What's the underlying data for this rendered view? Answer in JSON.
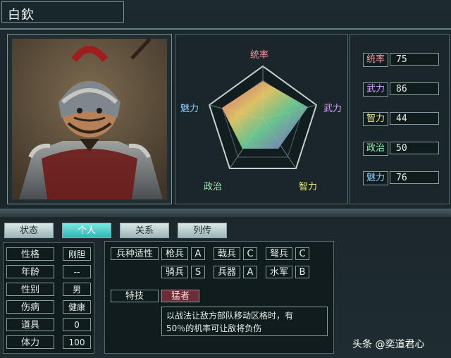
{
  "general": {
    "name": "白欽"
  },
  "radar": {
    "labels": {
      "top": "统率",
      "right": "武力",
      "bottom_right": "智力",
      "bottom_left": "政治",
      "left": "魅力"
    }
  },
  "stats": [
    {
      "label": "统率",
      "value": "75",
      "color": "#ff9aa5"
    },
    {
      "label": "武力",
      "value": "86",
      "color": "#d7a6ff"
    },
    {
      "label": "智力",
      "value": "44",
      "color": "#f2f17e"
    },
    {
      "label": "政治",
      "value": "50",
      "color": "#9ef0b8"
    },
    {
      "label": "魅力",
      "value": "76",
      "color": "#91d0ff"
    }
  ],
  "tabs": [
    {
      "label": "状态",
      "active": false
    },
    {
      "label": "个人",
      "active": true
    },
    {
      "label": "关系",
      "active": false
    },
    {
      "label": "列传",
      "active": false
    }
  ],
  "personal": [
    {
      "label": "性格",
      "value": "刚胆"
    },
    {
      "label": "年龄",
      "value": "--"
    },
    {
      "label": "性别",
      "value": "男"
    },
    {
      "label": "伤病",
      "value": "健康"
    },
    {
      "label": "道具",
      "value": "0"
    },
    {
      "label": "体力",
      "value": "100"
    }
  ],
  "aptitude": {
    "title": "兵种适性",
    "rows": [
      [
        {
          "unit": "枪兵",
          "grade": "A"
        },
        {
          "unit": "戟兵",
          "grade": "C"
        },
        {
          "unit": "弩兵",
          "grade": "C"
        }
      ],
      [
        {
          "unit": "骑兵",
          "grade": "S"
        },
        {
          "unit": "兵器",
          "grade": "A"
        },
        {
          "unit": "水军",
          "grade": "B"
        }
      ]
    ]
  },
  "skill": {
    "title": "特技",
    "name": "猛者",
    "description_line1": "以战法让敌方部队移动区格时，有",
    "description_line2": "50％的机率可让敌将负伤"
  },
  "watermark": "头条 @奕道君心"
}
